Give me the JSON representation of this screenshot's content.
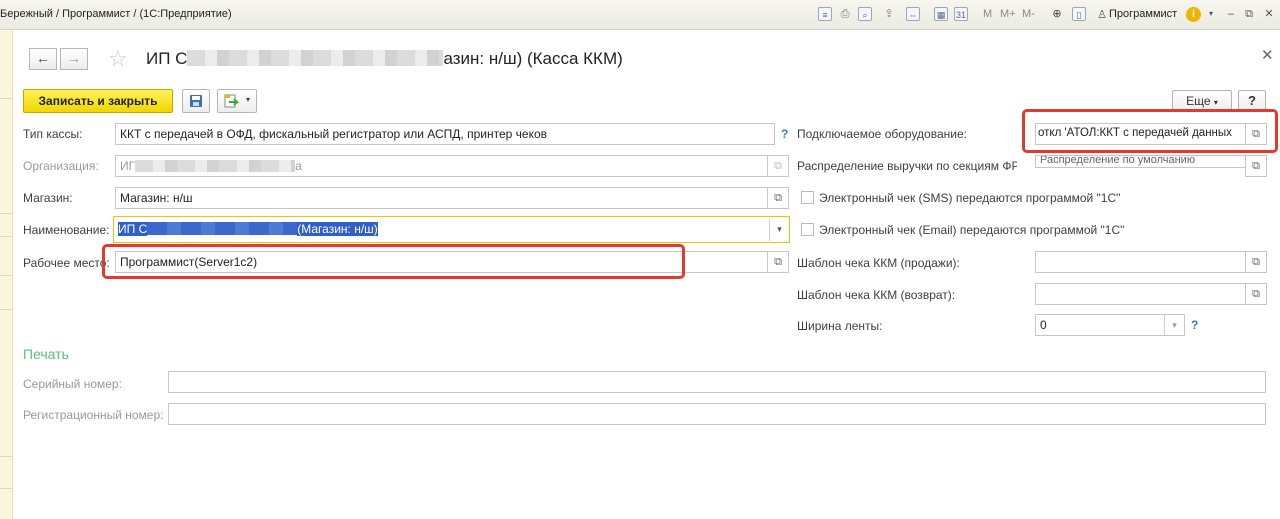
{
  "window": {
    "title": "Бережный / Программист / (1С:Предприятие)",
    "toolbar_letters": [
      "M",
      "M+",
      "M-"
    ],
    "user": "Программист"
  },
  "form": {
    "title_start": "ИП С",
    "title_end": "азин: н/ш) (Касса ККМ)",
    "save_close": "Записать и закрыть",
    "more": "Еще",
    "help": "?"
  },
  "left": {
    "cash_type_label": "Тип кассы:",
    "cash_type_value": "ККТ с передачей в ОФД, фискальный регистратор или АСПД, принтер чеков",
    "org_label": "Организация:",
    "org_value_start": "ИГ",
    "org_value_end": "а",
    "store_label": "Магазин:",
    "store_value": "Магазин: н/ш",
    "name_label": "Наименование:",
    "name_value_start": "ИП С",
    "name_value_end": "(Магазин: н/ш)",
    "workplace_label": "Рабочее место:",
    "workplace_value": "Программист(Server1c2)"
  },
  "right": {
    "equipment_label": "Подключаемое оборудование:",
    "equipment_value": "откл 'АТОЛ:ККТ с передачей данных",
    "revenue_label": "Распределение выручки по секциям ФР:",
    "revenue_value": "Распределение по умолчанию",
    "sms_label": "Электронный чек (SMS) передаются программой \"1С\"",
    "email_label": "Электронный чек (Email) передаются программой \"1С\"",
    "template_sale_label": "Шаблон чека ККМ (продажи):",
    "template_return_label": "Шаблон чека ККМ (возврат):",
    "tape_width_label": "Ширина ленты:",
    "tape_width_value": "0"
  },
  "print": {
    "section_title": "Печать",
    "serial_label": "Серийный номер:",
    "reg_label": "Регистрационный номер:"
  },
  "colors": {
    "accent_yellow": "#f2d600",
    "highlight_red": "#e23a2f",
    "section_green": "#5cbf7c",
    "link_blue": "#2f7ac9"
  },
  "icons": {
    "back": "arrow-left-icon",
    "forward": "arrow-right-icon",
    "favorite": "star-icon",
    "close": "close-icon",
    "save": "floppy-disk-icon",
    "generate": "document-arrow-icon",
    "open": "open-window-icon"
  }
}
